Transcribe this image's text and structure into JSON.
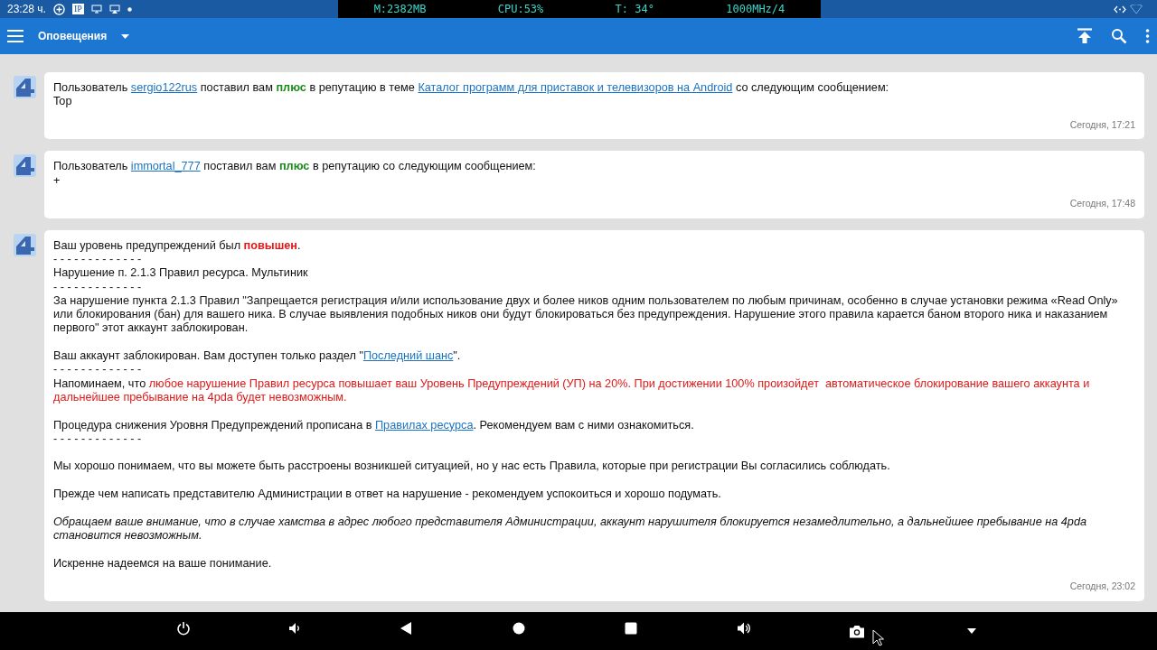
{
  "status_bar": {
    "time": "23:28 ч.",
    "ip_badge": "IP",
    "monitor": [
      "M:2382MB",
      "CPU:53%",
      "T: 34°",
      "1000MHz/4"
    ]
  },
  "toolbar": {
    "title": "Оповещения"
  },
  "notifications": [
    {
      "time": "Сегодня, 17:21",
      "blocks": [
        {
          "kind": "line",
          "segments": [
            {
              "kind": "text",
              "text": "Пользователь "
            },
            {
              "kind": "link",
              "text": "sergio122rus"
            },
            {
              "kind": "text",
              "text": " поставил вам "
            },
            {
              "kind": "positive",
              "text": "плюс"
            },
            {
              "kind": "text",
              "text": " в репутацию в теме "
            },
            {
              "kind": "link",
              "text": "Каталог программ для приставок и телевизоров на Android"
            },
            {
              "kind": "text",
              "text": " со следующим сообщением:"
            }
          ]
        },
        {
          "kind": "line",
          "segments": [
            {
              "kind": "text",
              "text": "Top"
            }
          ]
        }
      ]
    },
    {
      "time": "Сегодня, 17:48",
      "blocks": [
        {
          "kind": "line",
          "segments": [
            {
              "kind": "text",
              "text": "Пользователь "
            },
            {
              "kind": "link",
              "text": "immortal_777"
            },
            {
              "kind": "text",
              "text": " поставил вам "
            },
            {
              "kind": "positive",
              "text": "плюс"
            },
            {
              "kind": "text",
              "text": " в репутацию со следующим сообщением:"
            }
          ]
        },
        {
          "kind": "line",
          "segments": [
            {
              "kind": "text",
              "text": "+"
            }
          ]
        }
      ]
    },
    {
      "time": "Сегодня, 23:02",
      "blocks": [
        {
          "kind": "line",
          "segments": [
            {
              "kind": "text",
              "text": "Ваш уровень предупреждений был "
            },
            {
              "kind": "negative",
              "text": "повышен"
            },
            {
              "kind": "text",
              "text": "."
            }
          ]
        },
        {
          "kind": "separator",
          "text": "- - - - - - - - - - - - -"
        },
        {
          "kind": "line",
          "segments": [
            {
              "kind": "text",
              "text": "Нарушение п. 2.1.3 Правил ресурса. Мультиник"
            }
          ]
        },
        {
          "kind": "separator",
          "text": "- - - - - - - - - - - - -"
        },
        {
          "kind": "line",
          "segments": [
            {
              "kind": "text",
              "text": "За нарушение пункта 2.1.3 Правил \"Запрещается регистрация и/или использование двух и более ников одним пользователем по любым причинам, особенно в случае установки режима «Read Only» или блокирования (бан) для вашего ника. В случае выявления подобных ников они будут блокироваться без предупреждения. Нарушение этого правила карается баном второго ника и наказанием первого\" этот аккаунт заблокирован."
            }
          ]
        },
        {
          "kind": "gap"
        },
        {
          "kind": "line",
          "segments": [
            {
              "kind": "text",
              "text": "Ваш аккаунт заблокирован. Вам доступен только раздел \""
            },
            {
              "kind": "link",
              "text": "Последний шанс"
            },
            {
              "kind": "text",
              "text": "\"."
            }
          ]
        },
        {
          "kind": "separator",
          "text": "- - - - - - - - - - - - -"
        },
        {
          "kind": "line",
          "segments": [
            {
              "kind": "text",
              "text": "Напоминаем, что "
            },
            {
              "kind": "warning",
              "text": "любое нарушение Правил ресурса повышает ваш Уровень Предупреждений (УП) на 20%. При достижении 100% произойдет  автоматическое блокирование вашего аккаунта и дальнейшее пребывание на 4pda будет невозможным."
            }
          ]
        },
        {
          "kind": "gap"
        },
        {
          "kind": "line",
          "segments": [
            {
              "kind": "text",
              "text": "Процедура снижения Уровня Предупреждений прописана в "
            },
            {
              "kind": "link",
              "text": "Правилах ресурса"
            },
            {
              "kind": "text",
              "text": ". Рекомендуем вам с ними ознакомиться."
            }
          ]
        },
        {
          "kind": "separator",
          "text": "- - - - - - - - - - - - -"
        },
        {
          "kind": "gap"
        },
        {
          "kind": "line",
          "segments": [
            {
              "kind": "text",
              "text": "Мы хорошо понимаем, что вы можете быть расстроены возникшей ситуацией, но у нас есть Правила, которые при регистрации Вы согласились соблюдать."
            }
          ]
        },
        {
          "kind": "gap"
        },
        {
          "kind": "line",
          "segments": [
            {
              "kind": "text",
              "text": "Прежде чем написать представителю Администрации в ответ на нарушение - рекомендуем успокоиться и хорошо подумать."
            }
          ]
        },
        {
          "kind": "gap"
        },
        {
          "kind": "italic",
          "segments": [
            {
              "kind": "text",
              "text": "Обращаем ваше внимание, что в случае хамства в адрес любого представителя Администрации, аккаунт нарушителя блокируется незамедлительно, а дальнейшее пребывание на 4pda становится невозможным."
            }
          ]
        },
        {
          "kind": "gap"
        },
        {
          "kind": "line",
          "segments": [
            {
              "kind": "text",
              "text": "Искренне надеемся на ваше понимание."
            }
          ]
        }
      ]
    }
  ]
}
